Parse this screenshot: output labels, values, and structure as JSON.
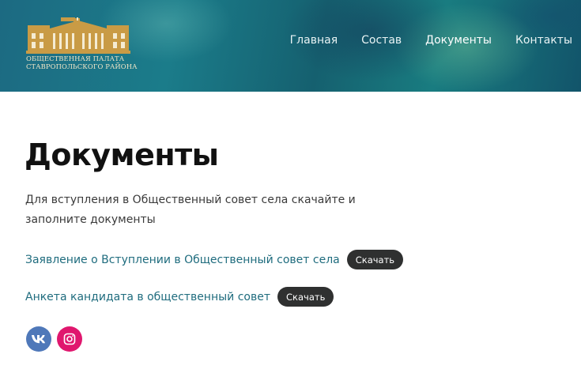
{
  "header": {
    "logo": {
      "line1": "Общественная палата",
      "line2": "Ставропольского района"
    },
    "nav": [
      {
        "label": "Главная"
      },
      {
        "label": "Состав"
      },
      {
        "label": "Документы",
        "active": true
      },
      {
        "label": "Контакты"
      }
    ]
  },
  "main": {
    "title": "Документы",
    "intro": "Для вступления в Общественный совет села скачайте и заполните документы",
    "documents": [
      {
        "title": "Заявление о Вступлении в Общественный совет села",
        "button": "Скачать"
      },
      {
        "title": "Анкета кандидата в общественный совет",
        "button": "Скачать"
      }
    ]
  },
  "social": [
    {
      "icon": "vk-icon"
    },
    {
      "icon": "instagram-icon"
    }
  ],
  "colors": {
    "header_bg": "#1b6f82",
    "link": "#1f6c7e",
    "button_bg": "#2f3030",
    "vk": "#4f78b9",
    "instagram": "#e0176e",
    "logo_gold": "#c99b45"
  }
}
